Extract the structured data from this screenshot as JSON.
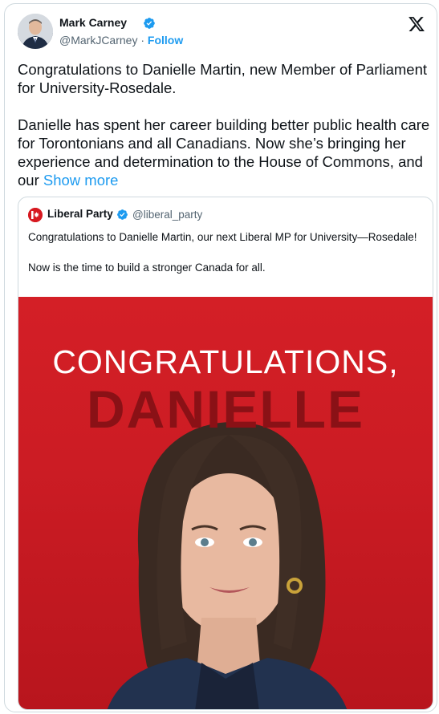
{
  "author": {
    "name": "Mark Carney",
    "handle": "@MarkJCarney",
    "separator": "·",
    "follow_label": "Follow"
  },
  "icons": {
    "verified": "verified-badge-icon",
    "platform": "x-logo-icon",
    "quoted_logo": "liberal-party-logo-icon"
  },
  "tweet": {
    "paragraph_1": "Congratulations to Danielle Martin, new Member of Parliament for University-Rosedale.",
    "paragraph_2": "Danielle has spent her career building better public health care for Torontonians and all Canadians. Now she’s bringing her experience and determination to the House of Commons, and our",
    "show_more": "Show more"
  },
  "quoted": {
    "name": "Liberal Party",
    "handle": "@liberal_party",
    "paragraph_1": "Congratulations to Danielle Martin, our next Liberal MP for University—Rosedale!",
    "paragraph_2": "Now is the time to build a stronger Canada for all.",
    "image_line_1": "CONGRATULATIONS,",
    "image_line_2": "DANIELLE"
  },
  "colors": {
    "accent": "#1d9bf0",
    "liberal_red": "#d71920",
    "image_bg": "#cc1c24",
    "image_name_text": "#8a1116"
  }
}
